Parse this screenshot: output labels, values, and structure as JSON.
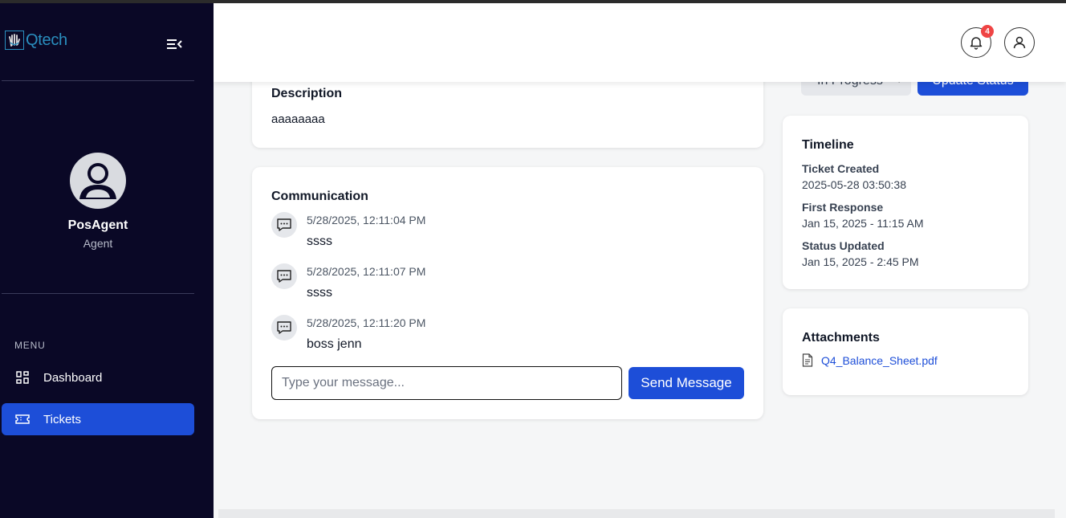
{
  "app": {
    "logo_text": "Qtech"
  },
  "sidebar": {
    "user": {
      "name": "PosAgent",
      "role": "Agent"
    },
    "menu_label": "MENU",
    "items": [
      {
        "label": "Dashboard",
        "icon": "dashboard-grid-icon",
        "active": false
      },
      {
        "label": "Tickets",
        "icon": "ticket-icon",
        "active": true
      }
    ]
  },
  "header": {
    "notification_count": "4"
  },
  "status": {
    "selected": "In Progress",
    "update_label": "Update Status"
  },
  "description": {
    "title": "Description",
    "text": "aaaaaaaa"
  },
  "communication": {
    "title": "Communication",
    "messages": [
      {
        "time": "5/28/2025, 12:11:04 PM",
        "text": "ssss"
      },
      {
        "time": "5/28/2025, 12:11:07 PM",
        "text": "ssss"
      },
      {
        "time": "5/28/2025, 12:11:20 PM",
        "text": "boss jenn"
      }
    ],
    "input_placeholder": "Type your message...",
    "send_label": "Send Message"
  },
  "timeline": {
    "title": "Timeline",
    "entries": [
      {
        "label": "Ticket Created",
        "value": "2025-05-28 03:50:38"
      },
      {
        "label": "First Response",
        "value": "Jan 15, 2025 - 11:15 AM"
      },
      {
        "label": "Status Updated",
        "value": "Jan 15, 2025 - 2:45 PM"
      }
    ]
  },
  "attachments": {
    "title": "Attachments",
    "files": [
      {
        "name": "Q4_Balance_Sheet.pdf",
        "icon": "document-icon"
      }
    ]
  },
  "colors": {
    "sidebar_bg": "#0a0826",
    "accent": "#1d4ed8",
    "badge": "#ef4444",
    "page_bg": "#f5f6f7"
  }
}
